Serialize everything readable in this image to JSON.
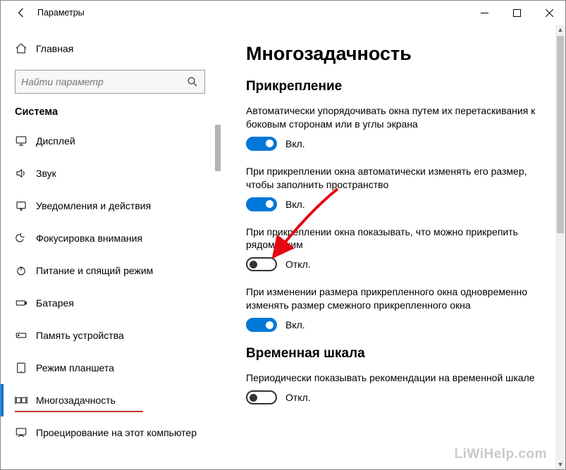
{
  "window": {
    "title": "Параметры"
  },
  "sidebar": {
    "home": "Главная",
    "search_placeholder": "Найти параметр",
    "section": "Система",
    "items": [
      {
        "id": "display",
        "label": "Дисплей"
      },
      {
        "id": "sound",
        "label": "Звук"
      },
      {
        "id": "notify",
        "label": "Уведомления и действия"
      },
      {
        "id": "focus",
        "label": "Фокусировка внимания"
      },
      {
        "id": "power",
        "label": "Питание и спящий режим"
      },
      {
        "id": "battery",
        "label": "Батарея"
      },
      {
        "id": "storage",
        "label": "Память устройства"
      },
      {
        "id": "tablet",
        "label": "Режим планшета"
      },
      {
        "id": "multitask",
        "label": "Многозадачность"
      },
      {
        "id": "project",
        "label": "Проецирование на этот компьютер"
      }
    ],
    "active_index": 8
  },
  "content": {
    "heading": "Многозадачность",
    "sections": [
      {
        "title": "Прикрепление",
        "settings": [
          {
            "desc": "Автоматически упорядочивать окна путем их перетаскивания к боковым сторонам или в углы экрана",
            "on": true,
            "state_label": "Вкл."
          },
          {
            "desc": "При прикреплении окна автоматически изменять его размер, чтобы заполнить пространство",
            "on": true,
            "state_label": "Вкл."
          },
          {
            "desc": "При прикреплении окна показывать, что можно прикрепить рядом с ним",
            "on": false,
            "state_label": "Откл."
          },
          {
            "desc": "При изменении размера прикрепленного окна одновременно изменять размер смежного прикрепленного окна",
            "on": true,
            "state_label": "Вкл."
          }
        ]
      },
      {
        "title": "Временная шкала",
        "settings": [
          {
            "desc": "Периодически показывать рекомендации на временной шкале",
            "on": false,
            "state_label": "Откл."
          }
        ]
      }
    ]
  },
  "watermark": "LiWiHelp.com"
}
